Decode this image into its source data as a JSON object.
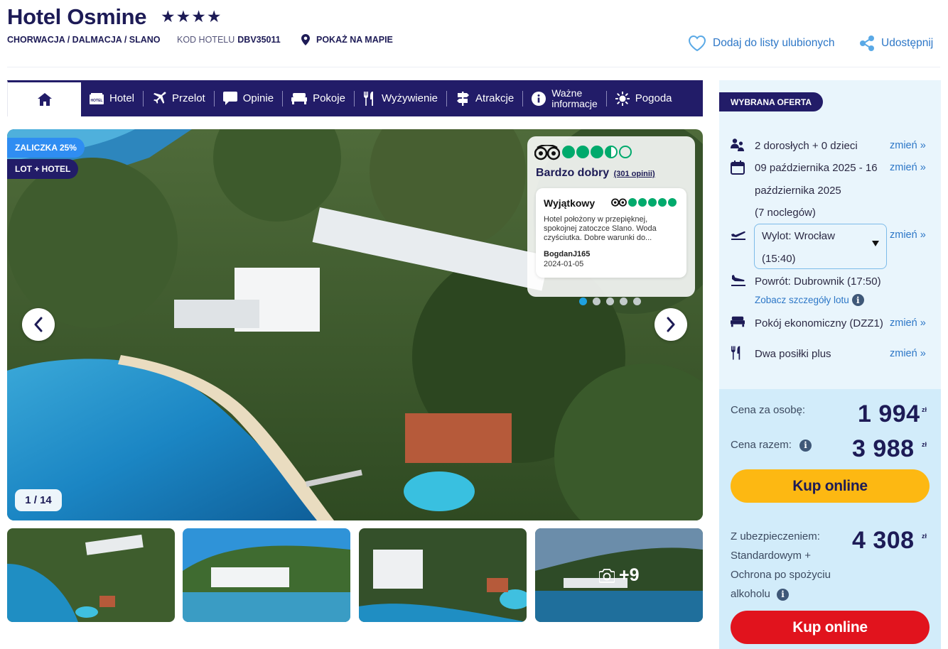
{
  "header": {
    "title": "Hotel Osmine",
    "stars": "★★★★",
    "breadcrumb": "CHORWACJA / DALMACJA / SLANO",
    "code_label": "KOD HOTELU",
    "code_value": "DBV35011",
    "map_link": "POKAŻ NA MAPIE",
    "favorite": "Dodaj do listy ulubionych",
    "share": "Udostępnij"
  },
  "nav": {
    "items": [
      {
        "label": "Hotel",
        "icon": "hotel-icon"
      },
      {
        "label": "Przelot",
        "icon": "plane-icon"
      },
      {
        "label": "Opinie",
        "icon": "speech-bubble-icon"
      },
      {
        "label": "Pokoje",
        "icon": "bed-icon"
      },
      {
        "label": "Wyżywienie",
        "icon": "cutlery-icon"
      },
      {
        "label": "Atrakcje",
        "icon": "signpost-icon"
      },
      {
        "label_line1": "Ważne",
        "label_line2": "informacje",
        "icon": "info-icon"
      },
      {
        "label": "Pogoda",
        "icon": "sun-icon"
      }
    ]
  },
  "gallery": {
    "badge_deposit": "ZALICZKA 25%",
    "badge_type": "LOT + HOTEL",
    "counter": "1 / 14",
    "more_photos": "+9",
    "review": {
      "rating_text": "Bardzo dobry",
      "reviews_link": "(301 opinii)",
      "rating_value": 3.5,
      "card_title": "Wyjątkowy",
      "card_rating": 5,
      "card_text": "Hotel położony w przepięknej, spokojnej zatoczce Slano. Woda czyściutka. Dobre warunki do...",
      "author": "BogdanJ165",
      "date": "2024-01-05"
    }
  },
  "offer": {
    "tag": "WYBRANA OFERTA",
    "change_label": "zmień »",
    "guests": "2 dorosłych + 0 dzieci",
    "dates_line1": "09 października 2025 - 16",
    "dates_line2": "października 2025",
    "nights": "(7 noclegów)",
    "departure_line1": "Wylot: Wrocław",
    "departure_line2": "(15:40)",
    "return": "Powrót: Dubrownik (17:50)",
    "flight_details": "Zobacz szczegóły lotu",
    "room": "Pokój ekonomiczny (DZZ1)",
    "board": "Dwa posiłki plus"
  },
  "prices": {
    "per_person_label": "Cena za osobę:",
    "per_person": "1 994",
    "total_label": "Cena razem:",
    "total": "3 988",
    "currency": "zł",
    "buy_label": "Kup online",
    "insured_line1": "Z ubezpieczeniem:",
    "insured_line2": "Standardowym +",
    "insured_line3": "Ochrona po spożyciu",
    "insured_line4": "alkoholu",
    "insured_price": "4 308"
  },
  "colors": {
    "navy": "#221c68",
    "accent_blue": "#2d77c7",
    "yellow_button": "#fdb812",
    "red_button": "#e1131d",
    "tripadvisor_green": "#00aa6c"
  }
}
